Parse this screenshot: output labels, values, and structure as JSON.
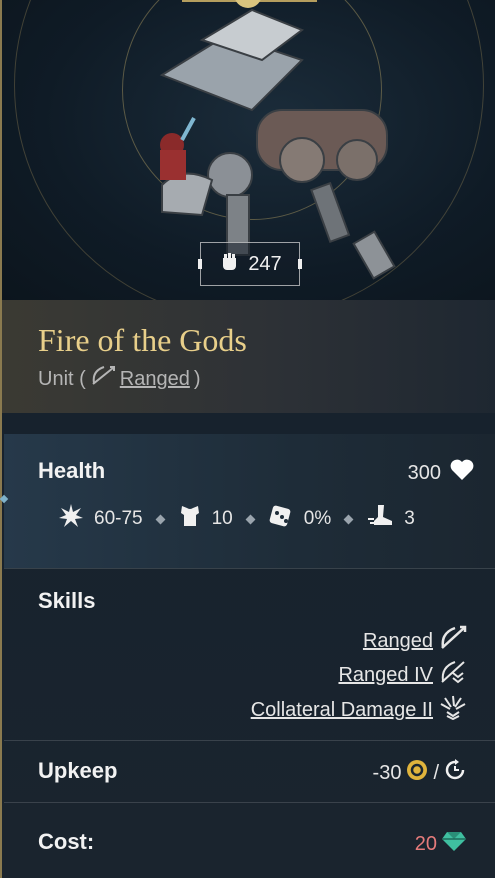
{
  "hero": {
    "power_value": "247"
  },
  "unit": {
    "name": "Fire of the Gods",
    "type_prefix": "Unit (",
    "type_link": "Ranged",
    "type_suffix": ")"
  },
  "health": {
    "label": "Health",
    "value": "300",
    "stats": {
      "damage": "60-75",
      "defense": "10",
      "chance": "0%",
      "movement": "3"
    }
  },
  "skills": {
    "label": "Skills",
    "items": [
      "Ranged",
      "Ranged IV",
      "Collateral Damage II"
    ]
  },
  "upkeep": {
    "label": "Upkeep",
    "value": "-30",
    "separator": "/"
  },
  "cost": {
    "label": "Cost:",
    "value": "20"
  },
  "colors": {
    "accent_gold": "#e8cf8a",
    "cost_red": "#e57b7b",
    "gem_teal": "#3fbfa0"
  },
  "icons": [
    "fist-icon",
    "ranged-icon",
    "heart-icon",
    "burst-icon",
    "armor-icon",
    "dice-icon",
    "boot-icon",
    "ranged-iv-icon",
    "collateral-icon",
    "gold-coin-icon",
    "turn-icon",
    "gem-icon"
  ]
}
